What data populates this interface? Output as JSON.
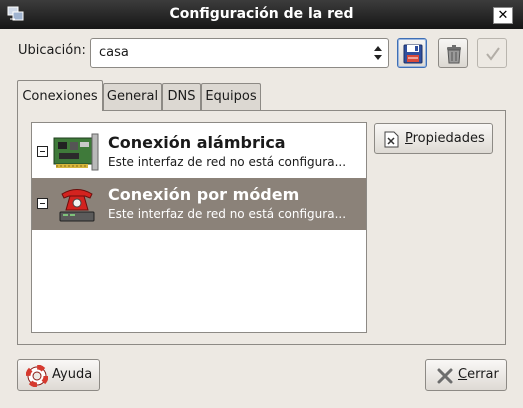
{
  "window": {
    "title": "Configuración de la red",
    "close_glyph": "✕"
  },
  "location": {
    "label": "Ubicación:",
    "value": "casa"
  },
  "toolbar": {
    "save_icon": "floppy-disk-icon",
    "delete_icon": "trash-icon",
    "apply_icon": "checkmark-icon"
  },
  "tabs": [
    {
      "label": "Conexiones",
      "active": true
    },
    {
      "label": "General",
      "active": false
    },
    {
      "label": "DNS",
      "active": false
    },
    {
      "label": "Equipos",
      "active": false
    }
  ],
  "connections": [
    {
      "name": "Conexión alámbrica",
      "description": "Este interfaz de red no está configura...",
      "icon": "network-card-icon",
      "selected": false
    },
    {
      "name": "Conexión por módem",
      "description": "Este interfaz de red no está configura...",
      "icon": "telephone-modem-icon",
      "selected": true
    }
  ],
  "buttons": {
    "properties": "Propiedades",
    "help": "Ayuda",
    "close": "Cerrar"
  },
  "colors": {
    "selection": "#8b8279",
    "titlebar": "#1e1e1e",
    "window_bg": "#ede9e3"
  }
}
